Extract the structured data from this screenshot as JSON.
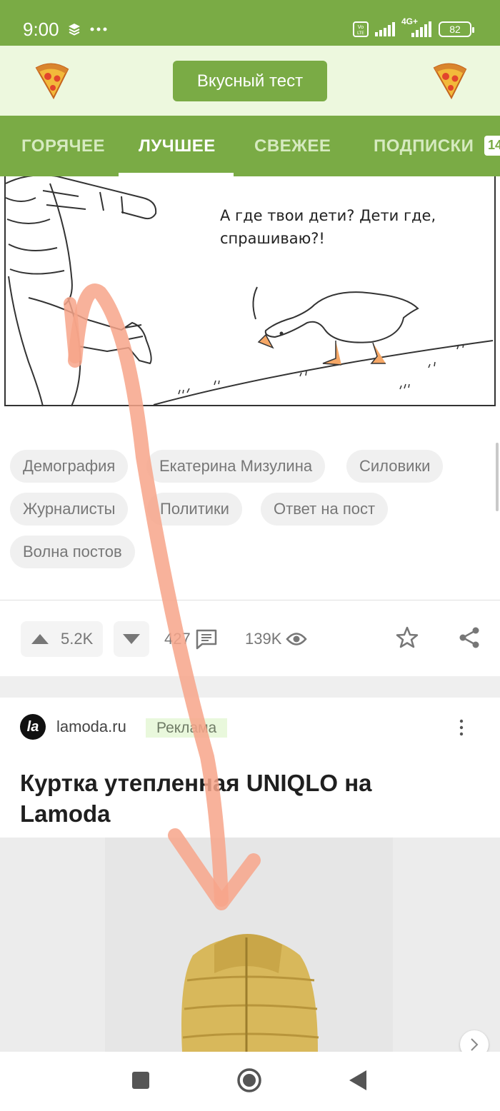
{
  "status_bar": {
    "time": "9:00",
    "battery": "82",
    "network": "4G+"
  },
  "header": {
    "cta_label": "Вкусный тест",
    "left_icon": "pizza-icon",
    "right_icon": "pizza-icon"
  },
  "tabs": [
    {
      "label": "ГОРЯЧЕЕ",
      "active": false
    },
    {
      "label": "ЛУЧШЕЕ",
      "active": true
    },
    {
      "label": "СВЕЖЕЕ",
      "active": false
    },
    {
      "label": "ПОДПИСКИ",
      "active": false,
      "badge": "14"
    }
  ],
  "post": {
    "comic_caption": "А где твои дети? Дети где, спрашиваю?!",
    "tags": [
      "Демография",
      "Екатерина Мизулина",
      "Силовики",
      "Журналисты",
      "Политики",
      "Ответ на пост",
      "Волна постов"
    ],
    "rating": "5.2K",
    "comments": "427",
    "views": "139K"
  },
  "ad": {
    "logo_text": "la",
    "source": "lamoda.ru",
    "badge": "Реклама",
    "title": "Куртка утепленная UNIQLO на Lamoda"
  },
  "colors": {
    "brand": "#7aab45",
    "header_bg": "#edf8de",
    "arrow": "#f7a589",
    "jacket": "#d8b85b"
  }
}
